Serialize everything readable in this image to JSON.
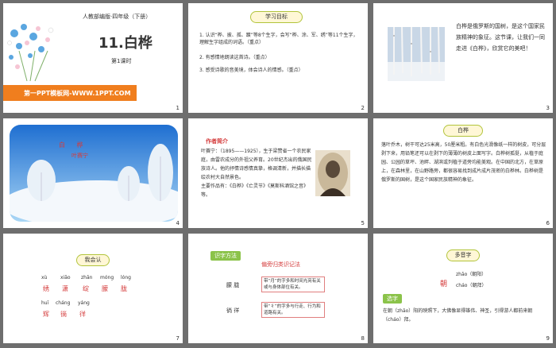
{
  "slides": [
    {
      "number": "1",
      "subtitle": "人教部编版·四年级（下册）",
      "title": "11.白桦",
      "period": "第1课时",
      "banner": "第一PPT模板网-WWW.1PPT.COM"
    },
    {
      "number": "2",
      "heading": "学习目标",
      "objectives": [
        "1. 认识“桦、披、孤、踱”等8个生字，会写“桦、涂、军、绣”等11个生字，理解生字组成的词语。（重点）",
        "2. 有感情地朗读这首诗。（重点）",
        "3. 感受诗歌的音美境，体会诗人的情感。（重点）"
      ]
    },
    {
      "number": "3",
      "text": "白桦是俄罗斯的国树，是这个国家民族精神的象征。这节课，让我们一同走进《白桦》，欣赏它的美吧！"
    },
    {
      "number": "4",
      "title": "白  桦",
      "author": "叶赛宁"
    },
    {
      "number": "5",
      "heading": "作者简介",
      "bio": "叶赛宁：（1895——1925），生于梁赞省一个农民家庭，由雷农成分的外祖父养育。20世纪杰出的俄国民族诗人。他的抒情诗感情真挚，格调清新，并描长描绘农村大自然景色。",
      "works": "主要作品有：《白桦》《亡灵节》《莫斯科酒馆之音》等。"
    },
    {
      "number": "6",
      "heading": "白桦",
      "text": "落叶乔木，树干可达25米高，50厘米粗。有白色光滑像纸一样的树皮，可分层剥下来，用铅笔还可以在剥下的薄薄的树皮上面写字。白桦树孤挺，从植于庭园、公园的草坪、池畔、湖滨或列植于道旁均能美观。在中国的北方，在草原上，在森林里，在山野路旁，都很容易找到成片成片茂密的白桦林。白桦树是俄罗斯的国树，是这个国家民族精神的象征。"
    },
    {
      "number": "7",
      "heading": "我会认",
      "pinyin_row1": [
        "xù",
        "xiāo",
        "zhān",
        "móng",
        "lóng"
      ],
      "chars_row1": [
        "绣",
        "潇",
        "绽",
        "朦",
        "胧"
      ],
      "pinyin_row2": [
        "huī",
        "cháng",
        "yáng"
      ],
      "chars_row2": [
        "辉",
        "徜",
        "徉"
      ]
    },
    {
      "number": "8",
      "tag": "识字方法",
      "rule": "偏旁归类识记法",
      "group1_chars": "朦  胧",
      "group1_note": "带“月”的字多和时间光亮有关或与身体部位有关。",
      "group2_chars": "徜  徉",
      "group2_note": "带“彳”的字多与行走、行为和道路有关。"
    },
    {
      "number": "9",
      "heading": "多音字",
      "char": "朝",
      "reading1": "zhāo（朝阳）",
      "reading2": "cháo（朝拜）",
      "tag": "选字",
      "sentence": "在朝（zhāo）阳的映照下，大佛像显得雄伟、神圣，引得游人都前来朝（cháo）拜。"
    }
  ]
}
